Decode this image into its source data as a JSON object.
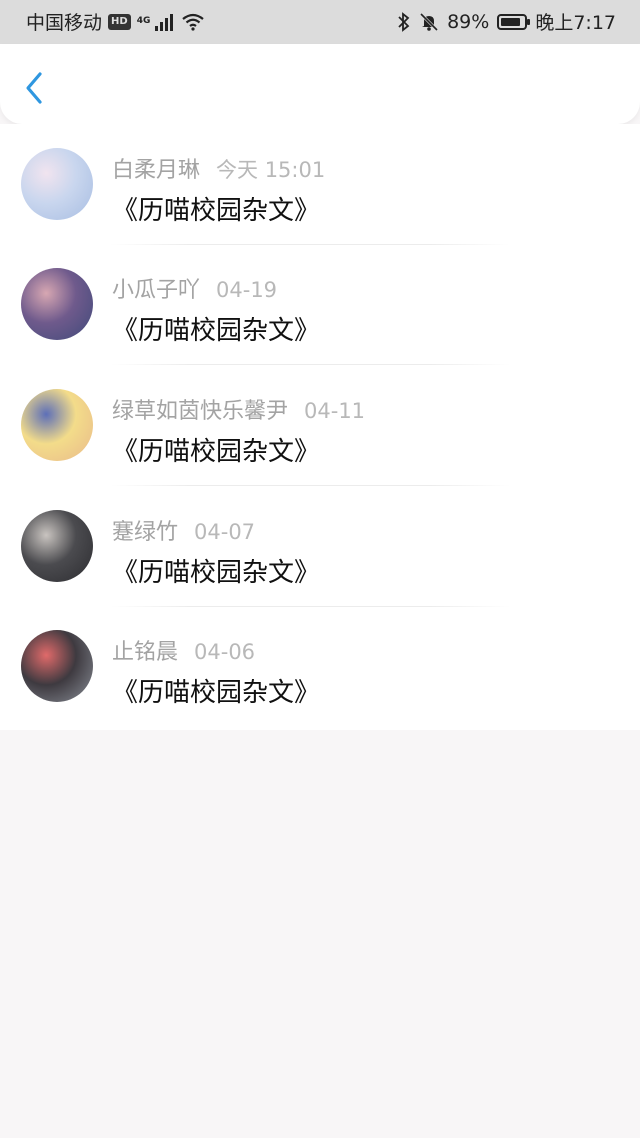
{
  "status_bar": {
    "carrier": "中国移动",
    "hd": "HD",
    "network": "4G",
    "battery_percent": "89%",
    "battery_level": 0.89,
    "time": "晚上7:17"
  },
  "items": [
    {
      "name": "白柔月琳",
      "date": "今天 15:01",
      "title": "《历喵校园杂文》",
      "avatar_colors": [
        "#c9d6ee",
        "#f1e4ef",
        "#a7bde2"
      ]
    },
    {
      "name": "小瓜子吖",
      "date": "04-19",
      "title": "《历喵校园杂文》",
      "avatar_colors": [
        "#6f5a8c",
        "#d7a7b2",
        "#3f4a7a"
      ]
    },
    {
      "name": "绿草如茵快乐馨尹",
      "date": "04-11",
      "title": "《历喵校园杂文》",
      "avatar_colors": [
        "#f3dc8a",
        "#5d6fb8",
        "#e9b98a"
      ]
    },
    {
      "name": "蹇绿竹",
      "date": "04-07",
      "title": "《历喵校园杂文》",
      "avatar_colors": [
        "#4b4b4f",
        "#c9c4c0",
        "#2c2c30"
      ]
    },
    {
      "name": "止铭晨",
      "date": "04-06",
      "title": "《历喵校园杂文》",
      "avatar_colors": [
        "#3e3a40",
        "#e06a6a",
        "#8a8f98"
      ]
    }
  ]
}
